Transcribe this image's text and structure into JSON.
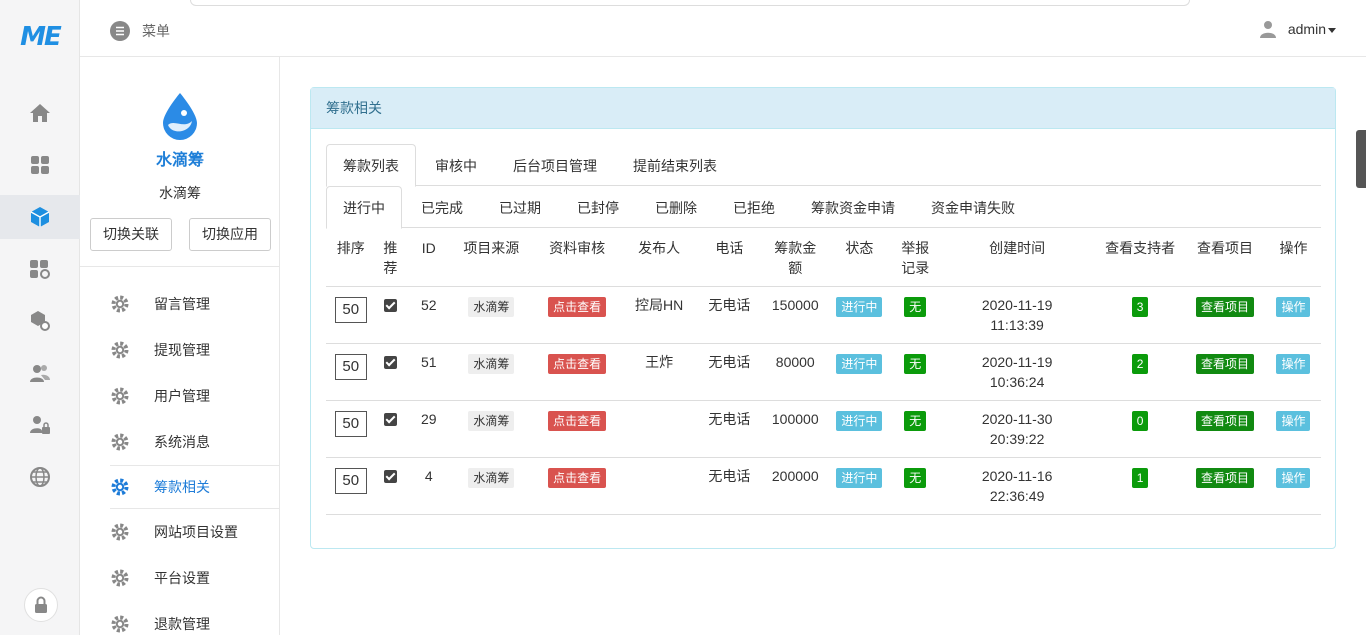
{
  "app": {
    "logo_text": "ME",
    "brand_name": "水滴筹",
    "brand_logo_text": "水滴筹"
  },
  "topbar": {
    "menu_label": "菜单",
    "user_name": "admin"
  },
  "sidebar": {
    "switch_link_label": "切换关联",
    "switch_app_label": "切换应用",
    "items": [
      {
        "label": "留言管理"
      },
      {
        "label": "提现管理"
      },
      {
        "label": "用户管理"
      },
      {
        "label": "系统消息"
      },
      {
        "label": "筹款相关"
      },
      {
        "label": "网站项目设置"
      },
      {
        "label": "平台设置"
      },
      {
        "label": "退款管理"
      }
    ]
  },
  "panel": {
    "title": "筹款相关",
    "tabs_main": [
      "筹款列表",
      "审核中",
      "后台项目管理",
      "提前结束列表"
    ],
    "tabs_sub": [
      "进行中",
      "已完成",
      "已过期",
      "已封停",
      "已删除",
      "已拒绝",
      "筹款资金申请",
      "资金申请失败"
    ],
    "columns": [
      "排序",
      "推荐",
      "ID",
      "项目来源",
      "资料审核",
      "发布人",
      "电话",
      "筹款金额",
      "状态",
      "举报记录",
      "创建时间",
      "查看支持者",
      "查看项目",
      "操作"
    ],
    "rows": [
      {
        "sort": "50",
        "id": "52",
        "source": "水滴筹",
        "review": "点击查看",
        "publisher": "控局HN",
        "phone": "无电话",
        "amount": "150000",
        "status": "进行中",
        "report": "无",
        "created_date": "2020-11-19",
        "created_time": "11:13:39",
        "supporters": "3",
        "view_project": "查看项目",
        "action": "操作"
      },
      {
        "sort": "50",
        "id": "51",
        "source": "水滴筹",
        "review": "点击查看",
        "publisher": "王炸",
        "phone": "无电话",
        "amount": "80000",
        "status": "进行中",
        "report": "无",
        "created_date": "2020-11-19",
        "created_time": "10:36:24",
        "supporters": "2",
        "view_project": "查看项目",
        "action": "操作"
      },
      {
        "sort": "50",
        "id": "29",
        "source": "水滴筹",
        "review": "点击查看",
        "publisher": "",
        "phone": "无电话",
        "amount": "100000",
        "status": "进行中",
        "report": "无",
        "created_date": "2020-11-30",
        "created_time": "20:39:22",
        "supporters": "0",
        "view_project": "查看项目",
        "action": "操作"
      },
      {
        "sort": "50",
        "id": "4",
        "source": "水滴筹",
        "review": "点击查看",
        "publisher": "",
        "phone": "无电话",
        "amount": "200000",
        "status": "进行中",
        "report": "无",
        "created_date": "2020-11-16",
        "created_time": "22:36:49",
        "supporters": "1",
        "view_project": "查看项目",
        "action": "操作"
      }
    ]
  },
  "colors": {
    "accent": "#1e7cd8",
    "panel_header": "#d9edf7",
    "danger": "#d9534f",
    "info": "#5bc0de",
    "success": "#0b9b0b"
  }
}
